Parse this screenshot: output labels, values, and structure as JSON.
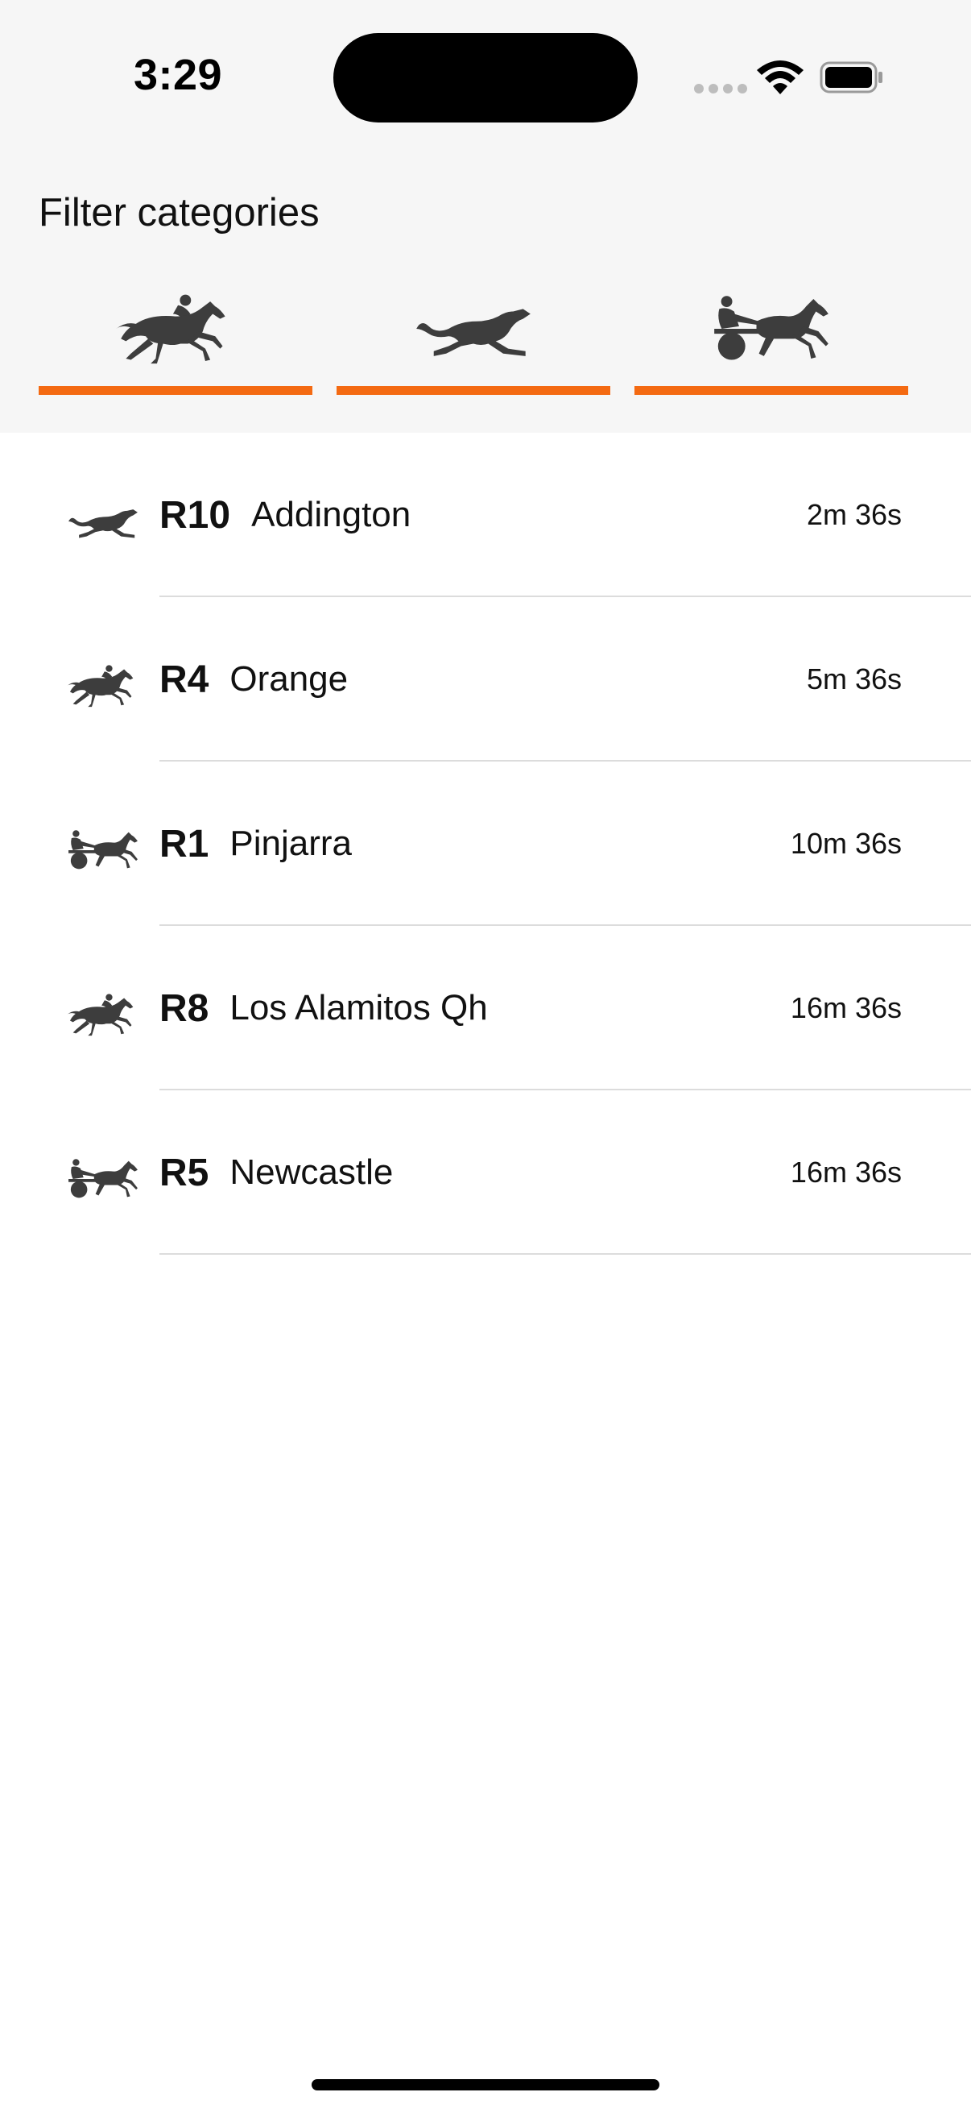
{
  "status_bar": {
    "time": "3:29"
  },
  "filter": {
    "title": "Filter categories",
    "accent_color": "#f46a12",
    "tabs": [
      {
        "icon": "horse-racing-icon"
      },
      {
        "icon": "greyhound-racing-icon"
      },
      {
        "icon": "harness-racing-icon"
      }
    ]
  },
  "races": [
    {
      "icon": "greyhound-racing-icon",
      "number": "R10",
      "venue": "Addington",
      "countdown": "2m 36s"
    },
    {
      "icon": "horse-racing-icon",
      "number": "R4",
      "venue": "Orange",
      "countdown": "5m 36s"
    },
    {
      "icon": "harness-racing-icon",
      "number": "R1",
      "venue": "Pinjarra",
      "countdown": "10m 36s"
    },
    {
      "icon": "horse-racing-icon",
      "number": "R8",
      "venue": "Los Alamitos Qh",
      "countdown": "16m 36s"
    },
    {
      "icon": "harness-racing-icon",
      "number": "R5",
      "venue": "Newcastle",
      "countdown": "16m 36s"
    }
  ]
}
